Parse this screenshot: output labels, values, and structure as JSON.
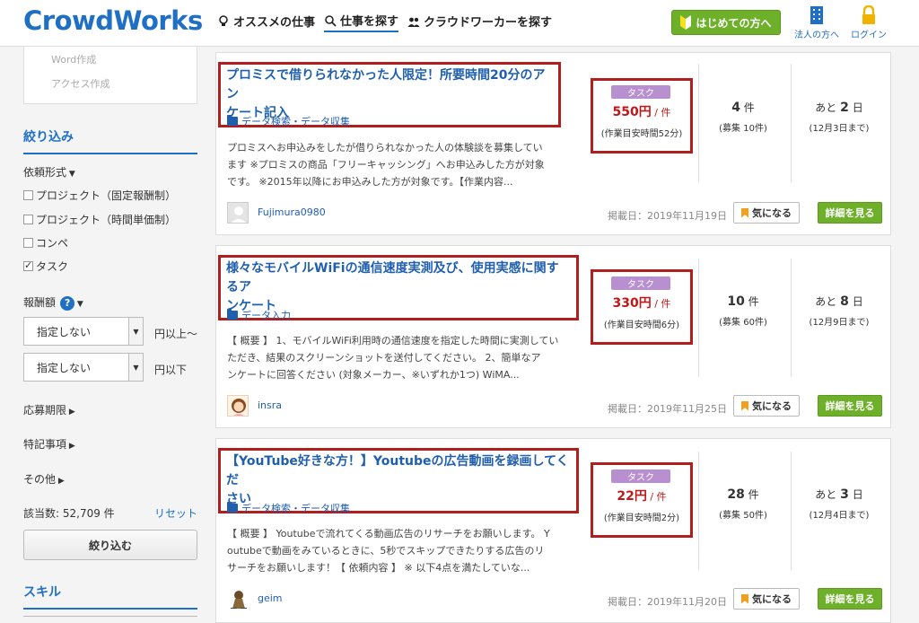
{
  "header": {
    "logo": "CrowdWorks",
    "nav": [
      {
        "label": "オススメの仕事"
      },
      {
        "label": "仕事を探す"
      },
      {
        "label": "クラウドワーカーを探す"
      }
    ],
    "first_btn": "はじめての方へ",
    "corp_link": "法人の方へ",
    "login_link": "ログイン"
  },
  "sidebar": {
    "prev_items": [
      "Word作成",
      "アクセス作成"
    ],
    "filter_heading": "絞り込み",
    "request_type_label": "依頼形式",
    "types": [
      {
        "label": "プロジェクト（固定報酬制）",
        "checked": false
      },
      {
        "label": "プロジェクト（時間単価制）",
        "checked": false
      },
      {
        "label": "コンペ",
        "checked": false
      },
      {
        "label": "タスク",
        "checked": true
      }
    ],
    "reward_label": "報酬額",
    "min_select": "指定しない",
    "min_suffix": "円以上〜",
    "max_select": "指定しない",
    "max_suffix": "円以下",
    "deadline_label": "応募期限",
    "notes_label": "特記事項",
    "other_label": "その他",
    "result_count": "該当数: 52,709 件",
    "reset": "リセット",
    "filter_button": "絞り込む",
    "skill_heading": "スキル"
  },
  "jobs": [
    {
      "title_1": "プロミスで借りられなかった人限定！所要時間20分のアン",
      "title_2": "ケート記入",
      "category": "データ検索・データ収集",
      "desc_1": "プロミスへお申込みをしたが借りられなかった人の体験談を募集してい",
      "desc_2": "ます ※プロミスの商品「フリーキャッシング」へお申込みした方が対象",
      "desc_3": "です。 ※2015年以降にお申込みした方が対象です。【作業内容...",
      "user": "Fujimura0980",
      "posted": "掲載日：2019年11月19日",
      "badge": "タスク",
      "price": "550円",
      "unit": " / 件",
      "est": "(作業目安時間52分)",
      "count": "4",
      "count_unit": "件",
      "recruit": "(募集 10件)",
      "days_prefix": "あと",
      "days": "2",
      "days_unit": "日",
      "until": "(12月3日まで)",
      "fav": "気になる",
      "detail": "詳細を見る"
    },
    {
      "title_1": "様々なモバイルWiFiの通信速度実測及び、使用実感に関するア",
      "title_2": "ンケート",
      "category": "データ入力",
      "desc_1": "【 概要 】 1、モバイルWiFi利用時の通信速度を指定した時間に実測してい",
      "desc_2": "ただき、結果のスクリーンショットを送付してください。 2、簡単なア",
      "desc_3": "ンケートに回答ください (対象メーカー、※いずれか1つ) WiMA...",
      "user": "insra",
      "posted": "掲載日：2019年11月25日",
      "badge": "タスク",
      "price": "330円",
      "unit": " / 件",
      "est": "(作業目安時間6分)",
      "count": "10",
      "count_unit": "件",
      "recruit": "(募集 60件)",
      "days_prefix": "あと",
      "days": "8",
      "days_unit": "日",
      "until": "(12月9日まで)",
      "fav": "気になる",
      "detail": "詳細を見る"
    },
    {
      "title_1": "【YouTube好きな方！】Youtubeの広告動画を録画してくだ",
      "title_2": "さい",
      "category": "データ検索・データ収集",
      "desc_1": "【 概要 】 Youtubeで流れてくる動画広告のリサーチをお願いします。 Y",
      "desc_2": "outubeで動画をみているときに、5秒でスキップできたりする広告のリ",
      "desc_3": "サーチをお願いします！【 依頼内容 】 ※ 以下4点を満たしていな...",
      "user": "geim",
      "posted": "掲載日：2019年11月20日",
      "badge": "タスク",
      "price": "22円",
      "unit": " / 件",
      "est": "(作業目安時間2分)",
      "count": "28",
      "count_unit": "件",
      "recruit": "(募集 50件)",
      "days_prefix": "あと",
      "days": "3",
      "days_unit": "日",
      "until": "(12月4日まで)",
      "fav": "気になる",
      "detail": "詳細を見る"
    }
  ],
  "colors": {
    "brand": "#1f6fc5",
    "green": "#6eb02a",
    "highlight": "#b01e1e",
    "price": "#c01818",
    "badge": "#b890d0"
  }
}
